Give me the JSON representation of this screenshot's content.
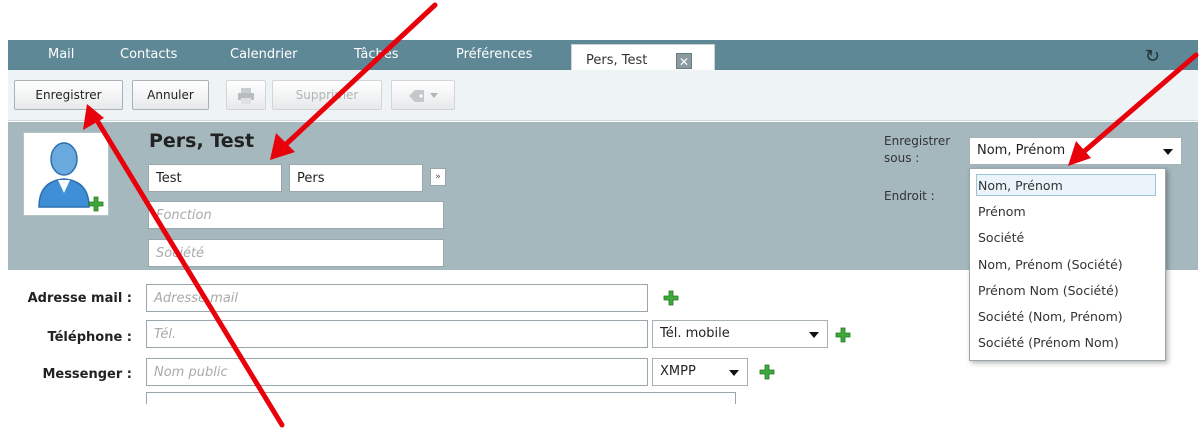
{
  "tabs": {
    "mail": "Mail",
    "contacts": "Contacts",
    "calendar": "Calendrier",
    "tasks": "Tâches",
    "preferences": "Préférences",
    "active": "Pers, Test",
    "close_glyph": "✕"
  },
  "toolbar": {
    "save": "Enregistrer",
    "cancel": "Annuler",
    "delete": "Supprimer"
  },
  "contact": {
    "display_name": "Pers, Test",
    "first_name": "Test",
    "last_name": "Pers",
    "expand_glyph": "»",
    "function_placeholder": "Fonction",
    "company_placeholder": "Société"
  },
  "save_as": {
    "label": "Enregistrer sous :",
    "label_line1": "Enregistrer",
    "label_line2": "sous :",
    "value": "Nom, Prénom",
    "location_label": "Endroit :",
    "options": [
      "Nom, Prénom",
      "Prénom",
      "Société",
      "Nom, Prénom (Société)",
      "Prénom Nom (Société)",
      "Société (Nom, Prénom)",
      "Société (Prénom Nom)"
    ]
  },
  "fields": {
    "email_label": "Adresse mail :",
    "email_placeholder": "Adresse mail",
    "phone_label": "Téléphone :",
    "phone_placeholder": "Tél.",
    "phone_type": "Tél. mobile",
    "messenger_label": "Messenger :",
    "messenger_placeholder": "Nom public",
    "messenger_type": "XMPP"
  },
  "colors": {
    "tabbar": "#5f8896",
    "header": "#a5b8be",
    "annotation_arrow": "#e8000b",
    "add_icon": "#3fa83a"
  }
}
